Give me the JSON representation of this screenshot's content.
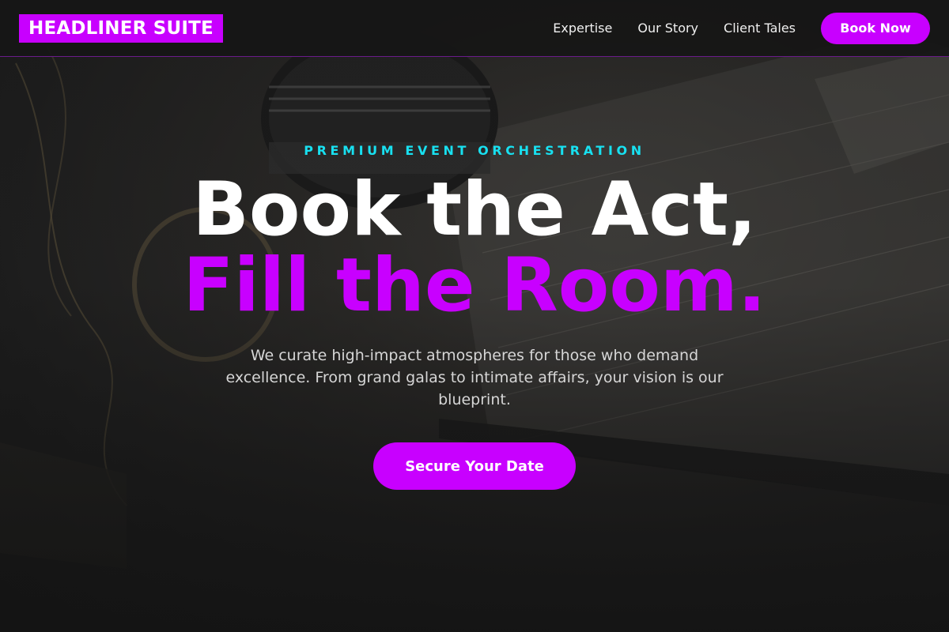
{
  "nav": {
    "logo": "HEADLINER SUITE",
    "links": [
      "Expertise",
      "Our Story",
      "Client Tales"
    ],
    "cta_label": "Book Now"
  },
  "hero": {
    "eyebrow": "PREMIUM EVENT ORCHESTRATION",
    "headline_line1": "Book the Act,",
    "headline_line2": "Fill the Room.",
    "description": "We curate high-impact atmospheres for those who demand excellence. From grand galas to intimate affairs, your vision is our blueprint.",
    "cta_label": "Secure Your Date"
  },
  "colors": {
    "accent": "#c800ff",
    "eyebrow": "#18e0f0",
    "background": "#141414"
  }
}
